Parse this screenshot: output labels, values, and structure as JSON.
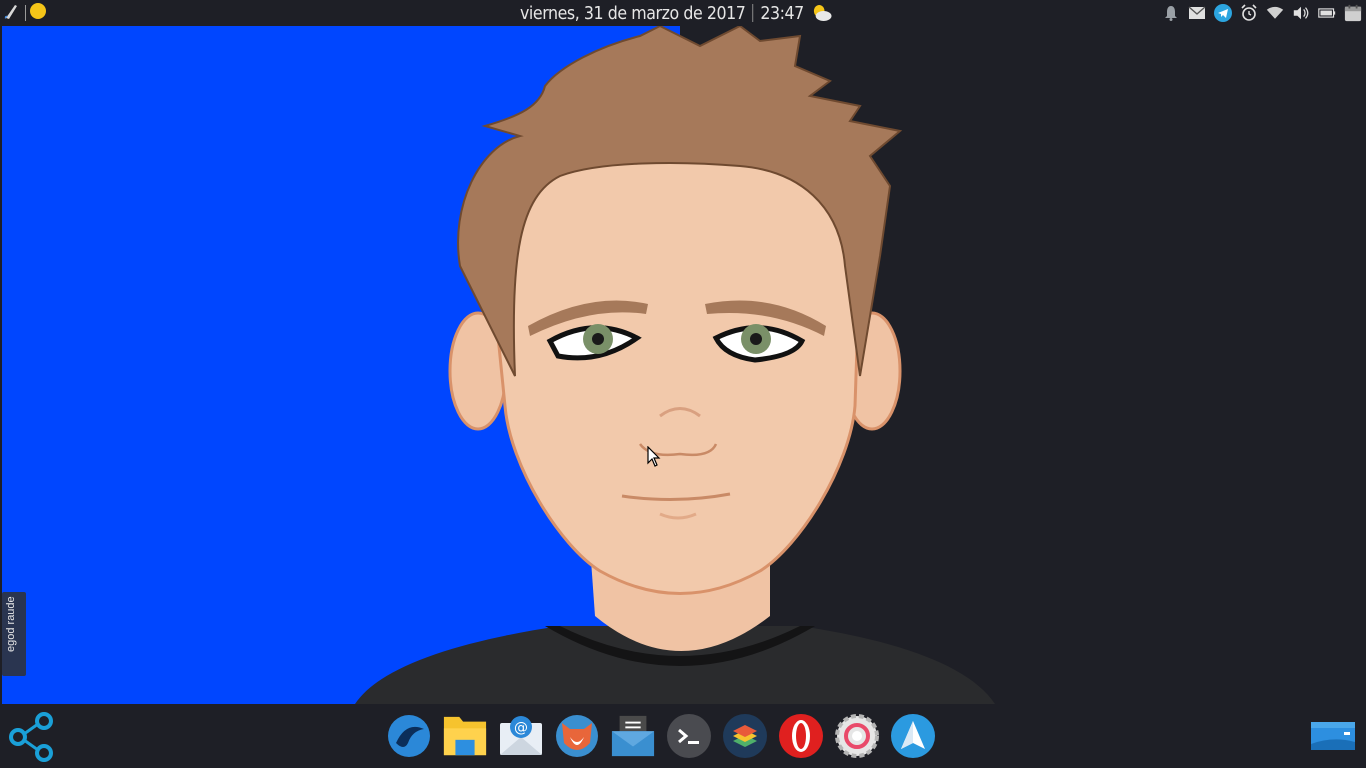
{
  "top_panel": {
    "date": "viernes, 31 de marzo de 2017",
    "time": "23:47",
    "left_icons": [
      "brush-icon",
      "circle-icon"
    ],
    "tray_icons": [
      "bell-icon",
      "mail-icon",
      "telegram-icon",
      "alarm-icon",
      "wifi-icon",
      "volume-icon",
      "battery-icon",
      "calendar-icon"
    ]
  },
  "desktop": {
    "widget_label": "egod raude",
    "wallpaper_color": "#0046ff"
  },
  "dock": {
    "launcher_icon": "share-icon",
    "apps": [
      "browser-icon",
      "folder-icon",
      "mail-client-icon",
      "firefox-icon",
      "mail-icon",
      "terminal-icon",
      "layers-icon",
      "opera-icon",
      "settings-icon",
      "send-icon"
    ],
    "right_icon": "desktop-icon"
  },
  "colors": {
    "panel_bg": "#1e1f26",
    "wallpaper_blue": "#0046ff",
    "accent_yellow": "#f5c518"
  }
}
